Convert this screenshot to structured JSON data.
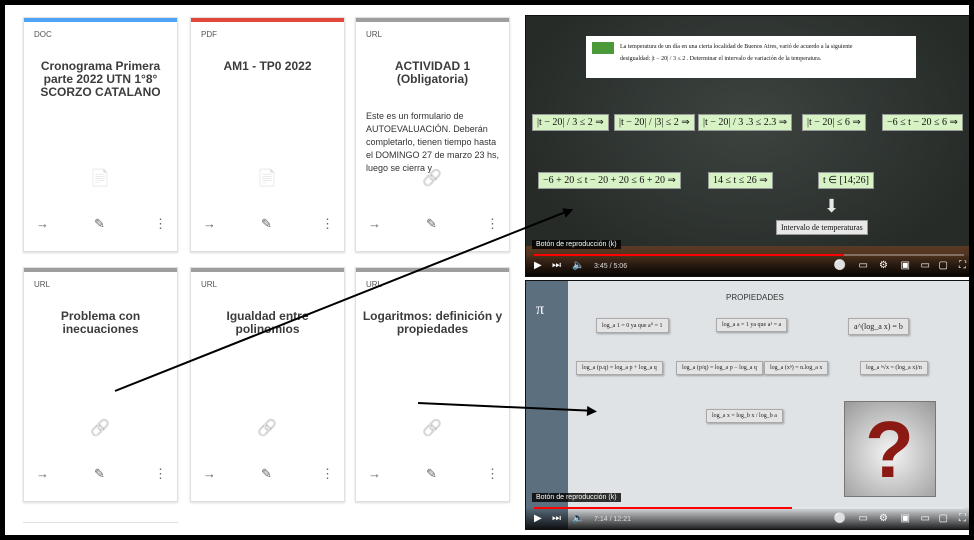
{
  "cards": [
    {
      "type": "DOC",
      "title": "Cronograma Primera parte 2022 UTN 1°8° SCORZO CATALANO",
      "color": "#4da3f5",
      "icon": "document-icon"
    },
    {
      "type": "PDF",
      "title": "AM1 - TP0 2022",
      "color": "#e3473a",
      "icon": "document-icon"
    },
    {
      "type": "URL",
      "title": "ACTIVIDAD 1 (Obligatoria)",
      "desc": "Este es un formulario de AUTOEVALUACIÓN. Deberán completarlo, tienen tiempo hasta el DOMINGO 27 de marzo 23 hs, luego se cierra y",
      "color": "#9e9e9e",
      "icon": "link-icon"
    },
    {
      "type": "URL",
      "title": "Problema con inecuaciones",
      "color": "#9e9e9e",
      "icon": "link-icon"
    },
    {
      "type": "URL",
      "title": "Igualdad entre polinomios",
      "color": "#9e9e9e",
      "icon": "link-icon"
    },
    {
      "type": "URL",
      "title": "Logaritmos: definición y propiedades",
      "color": "#9e9e9e",
      "icon": "link-icon"
    }
  ],
  "video1": {
    "statement_line1": "La temperatura de un día en una cierta localidad de Buenos Aires, varió de acuerdo a la siguiente",
    "statement_line2": "desigualdad: |t − 20| / 3 ≤ 2 . Determinar el intervalo de variación de la temperatura.",
    "row1": [
      "|t − 20| / 3 ≤ 2 ⇒",
      "|t − 20| / |3| ≤ 2 ⇒",
      "|t − 20| / 3 .3 ≤ 2.3 ⇒",
      "|t − 20| ≤ 6 ⇒",
      "−6 ≤ t − 20 ≤ 6 ⇒"
    ],
    "row2": [
      "−6 + 20 ≤ t − 20 + 20 ≤ 6 + 20 ⇒",
      "14 ≤ t ≤ 26 ⇒",
      "t ∈ [14;26]"
    ],
    "result_label": "Intervalo de temperaturas",
    "tooltip": "Botón de reproducción (k)",
    "time": "3:45 / 5:06",
    "progress": 0.72
  },
  "video2": {
    "heading": "PROPIEDADES",
    "pi": "π",
    "boxes": [
      "log_a 1 = 0   ya que  a⁰ = 1",
      "log_a a = 1   ya que  a¹ = a",
      "a^(log_a x) = b",
      "log_a (p.q) = log_a p + log_a q",
      "log_a (p/q) = log_a p − log_a q",
      "log_a (xⁿ) = n.log_a x",
      "log_a ⁿ√x = (log_a x)/n",
      "log_a x = log_b x / log_b a"
    ],
    "question_mark": "?",
    "tooltip": "Botón de reproducción (k)",
    "time": "7:14 / 12:21",
    "progress": 0.6
  }
}
